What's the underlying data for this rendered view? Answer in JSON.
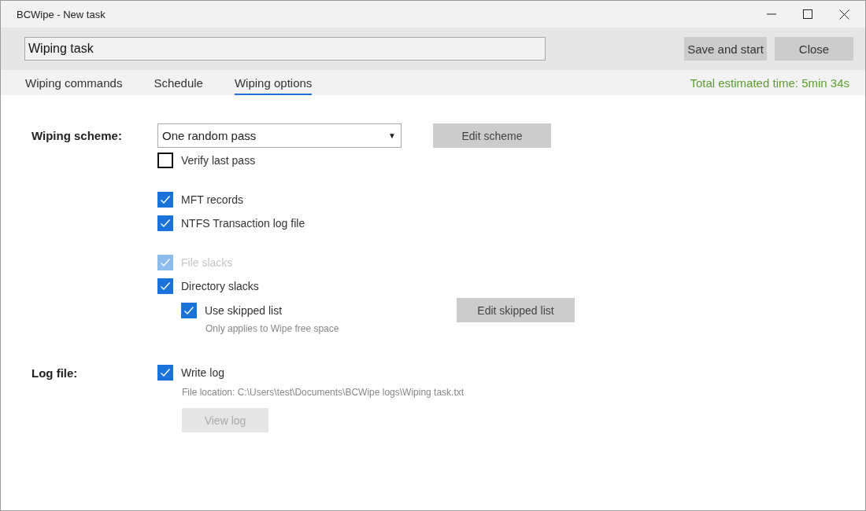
{
  "window": {
    "title": "BCWipe - New task"
  },
  "task_name": {
    "value": "Wiping task"
  },
  "header_buttons": [
    {
      "label": "Save and start"
    },
    {
      "label": "Close"
    }
  ],
  "tabs": [
    {
      "label": "Wiping commands",
      "selected": false
    },
    {
      "label": "Schedule",
      "selected": false
    },
    {
      "label": "Wiping options",
      "selected": true
    }
  ],
  "estimated_time": "Total estimated time: 5min 34s",
  "wiping_scheme": {
    "label": "Wiping scheme:",
    "value": "One random pass",
    "dropdown_arrow": "▼",
    "edit_button": "Edit scheme",
    "verify": {
      "label": "Verify last pass",
      "checked": false,
      "disabled": false
    }
  },
  "data_options": [
    {
      "label": "MFT records",
      "checked": true,
      "disabled": false
    },
    {
      "label": "NTFS Transaction log file",
      "checked": true,
      "disabled": false
    }
  ],
  "slack_options": [
    {
      "label": "File slacks",
      "checked": true,
      "disabled": true
    },
    {
      "label": "Directory slacks",
      "checked": true,
      "disabled": false,
      "children": [
        {
          "label": "Use skipped list",
          "checked": true,
          "disabled": false,
          "note": "Only applies to Wipe free space",
          "button": "Edit skipped list"
        }
      ]
    }
  ],
  "log_file": {
    "label": "Log file:",
    "write_log": {
      "label": "Write log",
      "checked": true,
      "disabled": false
    },
    "location": "File location: C:\\Users\\test\\Documents\\BCWipe logs\\Wiping task.txt",
    "view_button": {
      "label": "View log",
      "disabled": true
    }
  }
}
